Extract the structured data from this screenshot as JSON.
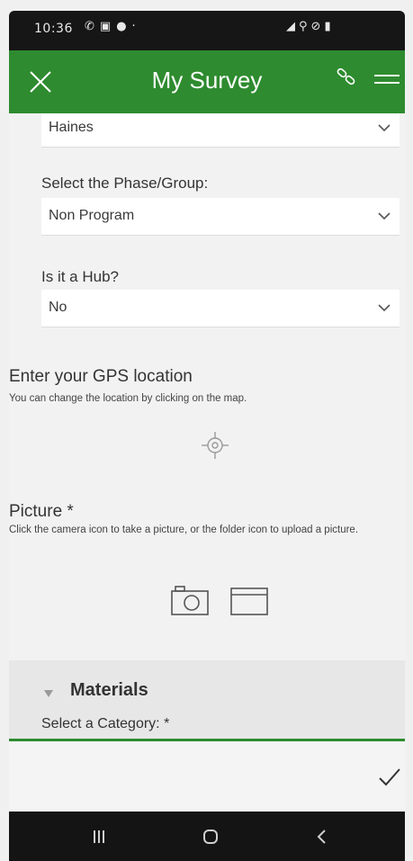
{
  "status_bar": {
    "time": "10:36",
    "left_icons": [
      "phone-icon",
      "image-icon",
      "chat-icon",
      "dot-icon"
    ],
    "right_icons": [
      "signal-icon",
      "location-icon",
      "mute-icon",
      "battery-icon"
    ]
  },
  "app_bar": {
    "title": "My Survey",
    "accent_color": "#2e8b2f"
  },
  "form": {
    "field1": {
      "value": "Haines"
    },
    "field2": {
      "label": "Select the Phase/Group:",
      "value": "Non Program"
    },
    "field3": {
      "label": "Is it a Hub?",
      "value": "No"
    },
    "gps": {
      "label": "Enter your GPS location",
      "hint": "You can change the location by clicking on the map."
    },
    "picture": {
      "label": "Picture *",
      "hint": "Click the camera icon to take a picture, or the folder icon to upload a picture."
    },
    "materials": {
      "title": "Materials",
      "category_label": "Select a Category: *"
    }
  },
  "nav_bar": {
    "items": [
      "recents-icon",
      "home-icon",
      "back-icon"
    ]
  }
}
